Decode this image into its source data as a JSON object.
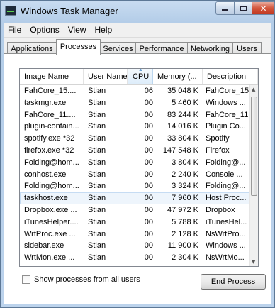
{
  "window": {
    "title": "Windows Task Manager"
  },
  "menu": [
    "File",
    "Options",
    "View",
    "Help"
  ],
  "tabs": [
    "Applications",
    "Processes",
    "Services",
    "Performance",
    "Networking",
    "Users"
  ],
  "active_tab": "Processes",
  "columns": [
    "Image Name",
    "User Name",
    "CPU",
    "Memory (...",
    "Description"
  ],
  "sorted_column": "CPU",
  "rows": [
    {
      "image": "FahCore_15....",
      "user": "Stian",
      "cpu": "06",
      "memory": "35 048 K",
      "desc": "FahCore_15"
    },
    {
      "image": "taskmgr.exe",
      "user": "Stian",
      "cpu": "00",
      "memory": "5 460 K",
      "desc": "Windows ..."
    },
    {
      "image": "FahCore_11....",
      "user": "Stian",
      "cpu": "00",
      "memory": "83 244 K",
      "desc": "FahCore_11"
    },
    {
      "image": "plugin-contain...",
      "user": "Stian",
      "cpu": "00",
      "memory": "14 016 K",
      "desc": "Plugin Co..."
    },
    {
      "image": "spotify.exe *32",
      "user": "Stian",
      "cpu": "00",
      "memory": "33 804 K",
      "desc": "Spotify"
    },
    {
      "image": "firefox.exe *32",
      "user": "Stian",
      "cpu": "00",
      "memory": "147 548 K",
      "desc": "Firefox"
    },
    {
      "image": "Folding@hom...",
      "user": "Stian",
      "cpu": "00",
      "memory": "3 804 K",
      "desc": "Folding@..."
    },
    {
      "image": "conhost.exe",
      "user": "Stian",
      "cpu": "00",
      "memory": "2 240 K",
      "desc": "Console ..."
    },
    {
      "image": "Folding@hom...",
      "user": "Stian",
      "cpu": "00",
      "memory": "3 324 K",
      "desc": "Folding@..."
    },
    {
      "image": "taskhost.exe",
      "user": "Stian",
      "cpu": "00",
      "memory": "7 960 K",
      "desc": "Host Proc..."
    },
    {
      "image": "Dropbox.exe ...",
      "user": "Stian",
      "cpu": "00",
      "memory": "47 972 K",
      "desc": "Dropbox"
    },
    {
      "image": "iTunesHelper....",
      "user": "Stian",
      "cpu": "00",
      "memory": "5 788 K",
      "desc": "iTunesHel..."
    },
    {
      "image": "WrtProc.exe ...",
      "user": "Stian",
      "cpu": "00",
      "memory": "2 128 K",
      "desc": "NsWrtPro..."
    },
    {
      "image": "sidebar.exe",
      "user": "Stian",
      "cpu": "00",
      "memory": "11 900 K",
      "desc": "Windows ..."
    },
    {
      "image": "WrtMon.exe ...",
      "user": "Stian",
      "cpu": "00",
      "memory": "2 304 K",
      "desc": "NsWrtMo..."
    }
  ],
  "selected_row_index": 9,
  "show_all_label": "Show processes from all users",
  "end_process_label": "End Process",
  "colors": {
    "title_gradient": "#c9dcf1",
    "selection": "#eef5fc",
    "close_button": "#d2553b"
  }
}
